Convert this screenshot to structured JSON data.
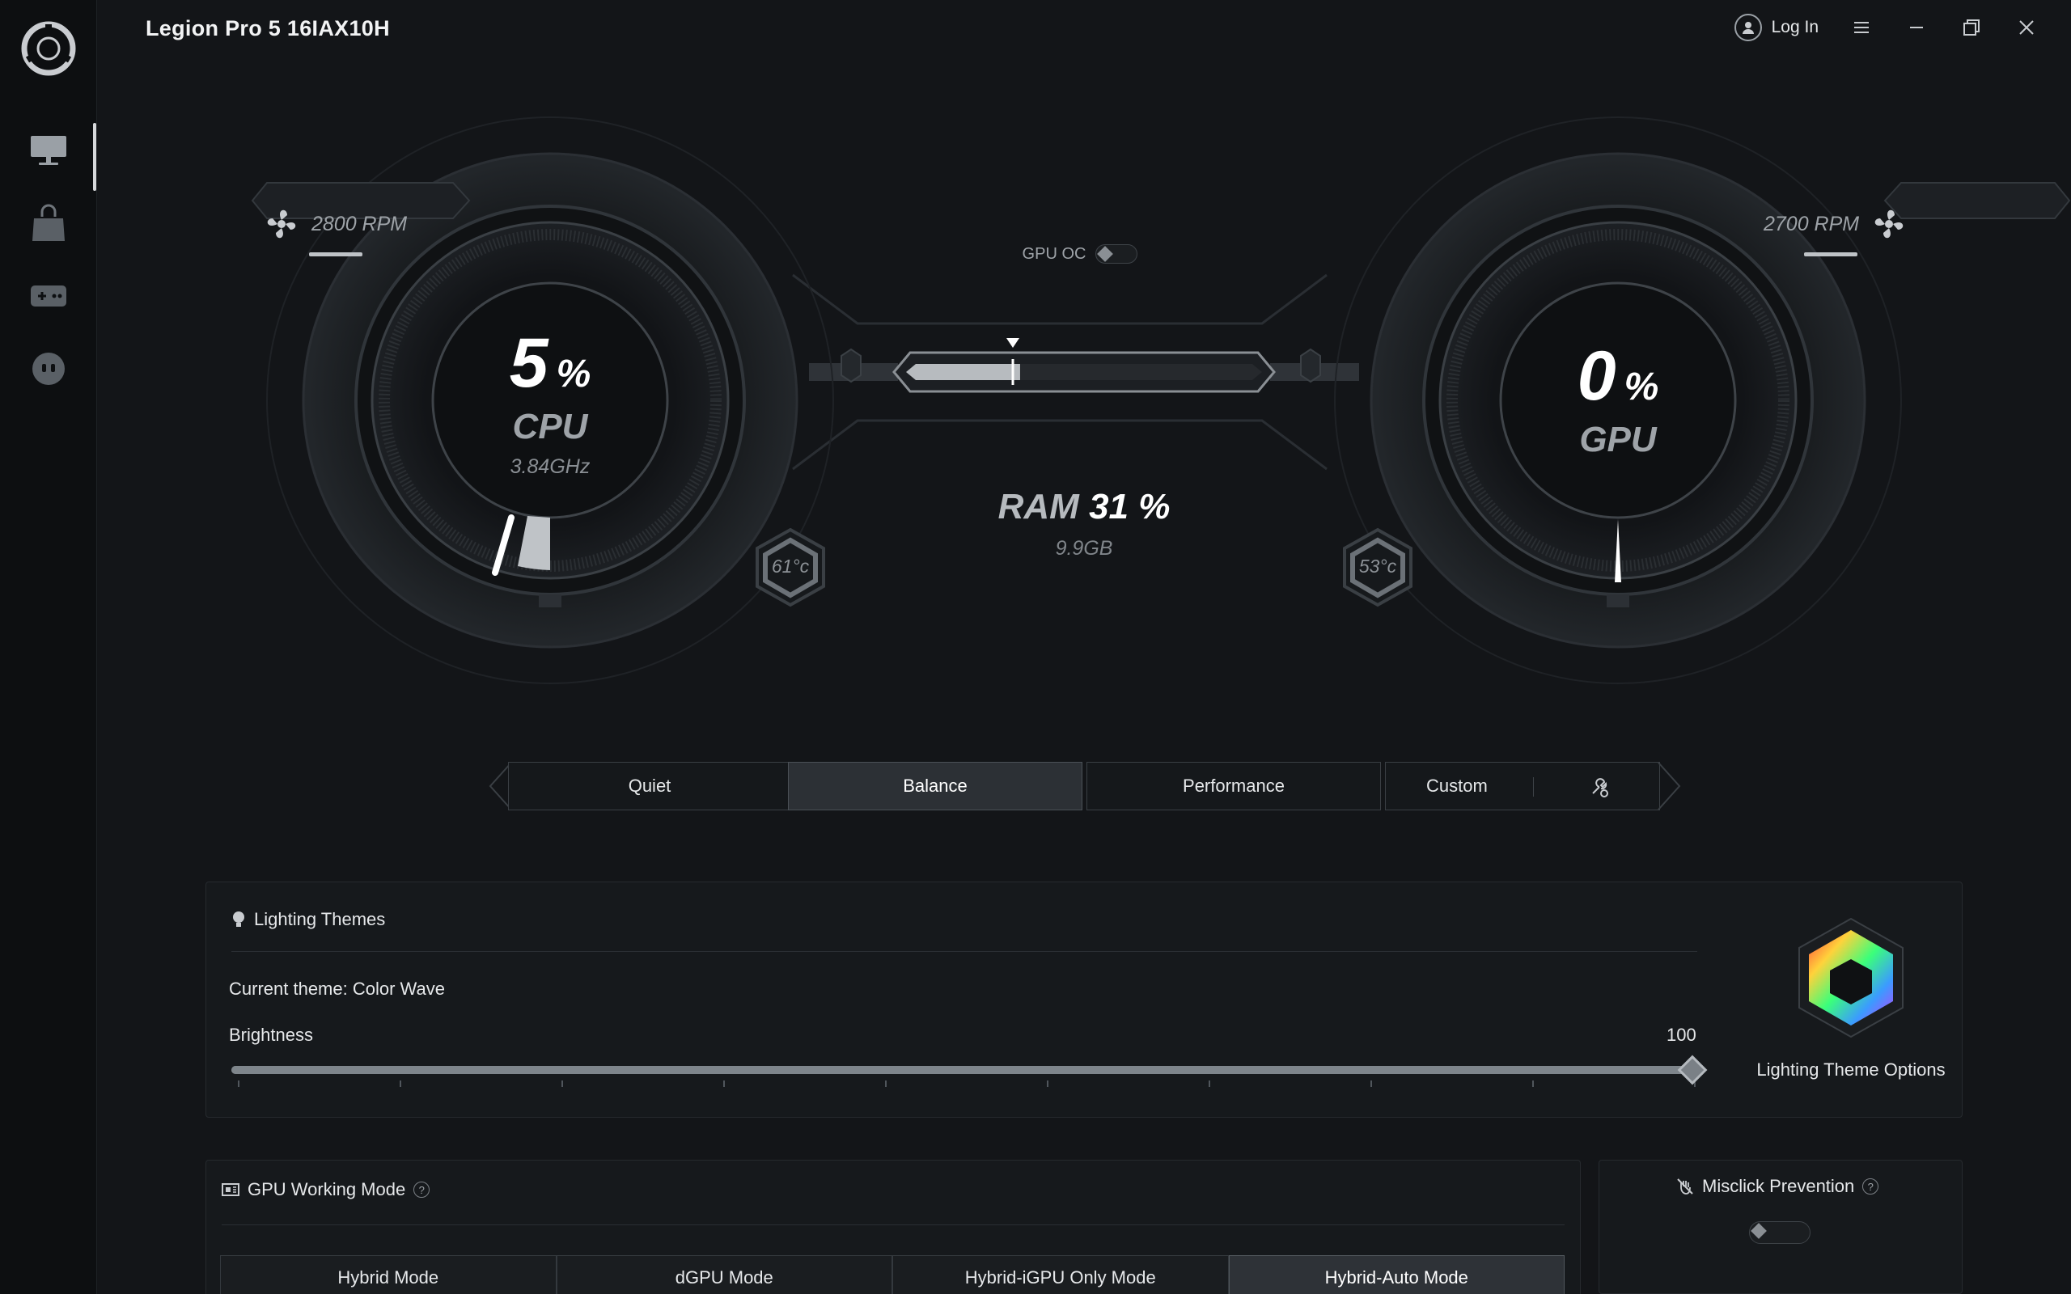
{
  "app": {
    "title": "Legion Pro 5 16IAX10H"
  },
  "titlebar": {
    "login_label": "Log In"
  },
  "sidebar": {
    "items": [
      {
        "name": "Device",
        "icon": "monitor-icon",
        "active": true
      },
      {
        "name": "Store",
        "icon": "shopping-bag-icon",
        "active": false
      },
      {
        "name": "Gaming",
        "icon": "gamepad-icon",
        "active": false
      },
      {
        "name": "Assistant",
        "icon": "robot-face-icon",
        "active": false
      }
    ]
  },
  "cpu": {
    "value": "5",
    "unit": "%",
    "label": "CPU",
    "freq": "3.84GHz",
    "fan": "2800 RPM",
    "temp": "61°c",
    "load": 0.05
  },
  "gpu": {
    "value": "0",
    "unit": "%",
    "label": "GPU",
    "fan": "2700 RPM",
    "temp": "53°c",
    "load": 0.0
  },
  "gpu_oc": {
    "label": "GPU OC",
    "enabled": false
  },
  "ram": {
    "label": "RAM",
    "value": "31",
    "unit": "%",
    "size": "9.9GB",
    "load": 0.31
  },
  "modes": [
    {
      "label": "Quiet",
      "active": false
    },
    {
      "label": "Balance",
      "active": true
    },
    {
      "label": "Performance",
      "active": false
    },
    {
      "label": "Custom",
      "active": false
    }
  ],
  "lighting": {
    "title": "Lighting Themes",
    "current_theme": "Current theme: Color Wave",
    "brightness_label": "Brightness",
    "brightness_value": "100",
    "brightness_level": 1.0,
    "options_label": "Lighting Theme Options"
  },
  "gpu_working_mode": {
    "title": "GPU Working Mode",
    "modes": [
      {
        "label": "Hybrid Mode",
        "active": false
      },
      {
        "label": "dGPU Mode",
        "active": false
      },
      {
        "label": "Hybrid-iGPU Only Mode",
        "active": false
      },
      {
        "label": "Hybrid-Auto Mode",
        "active": true
      }
    ]
  },
  "misclick": {
    "title": "Misclick Prevention",
    "enabled": false
  },
  "colors": {
    "background": "#131518",
    "sidebar": "#0d0f11",
    "accent": "#ffffff",
    "muted": "#9ea3a8"
  }
}
